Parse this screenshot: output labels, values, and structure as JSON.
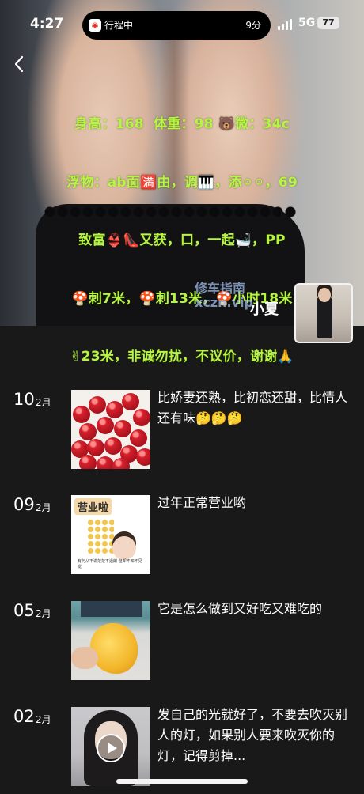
{
  "status_bar": {
    "time": "4:27",
    "live_activity_app": "行程中",
    "live_activity_app_icon": "ride-hailing-app-icon",
    "live_activity_eta": "9分",
    "network": "5G",
    "battery": "77"
  },
  "header": {
    "back_icon": "chevron-left-icon",
    "caption_lines": [
      "身高：168  体重：98 🐻微：34c",
      "浮物：ab面🈵由，调🎹，添⚪⚪，69",
      "致富👙👠又获，口，一起🛁，PP",
      "🍄刺7米，🍄刺13米，🍄小时18米",
      "✌23米，非诚勿扰，不议价，谢谢🙏"
    ],
    "watermark_line1": "修车指南",
    "watermark_line2": "xczn.vip",
    "profile_name": "小夏"
  },
  "posts": [
    {
      "day": "10",
      "month": "2月",
      "text": "比娇妻还熟，比初恋还甜，比情人还有味🤔🤔🤔",
      "thumb": "cherries"
    },
    {
      "day": "09",
      "month": "2月",
      "text": "过年正常营业哟",
      "thumb": "sticker",
      "sticker_tag": "营业啦",
      "sticker_small": "有何从不讲茫茫不透朗 但却不知不见觉"
    },
    {
      "day": "05",
      "month": "2月",
      "text": "它是怎么做到又好吃又难吃的",
      "thumb": "mango"
    },
    {
      "day": "02",
      "month": "2月",
      "text": "发自己的光就好了，不要去吹灭别人的灯，如果别人要来吹灭你的灯，记得剪掉...",
      "thumb": "video"
    }
  ]
}
